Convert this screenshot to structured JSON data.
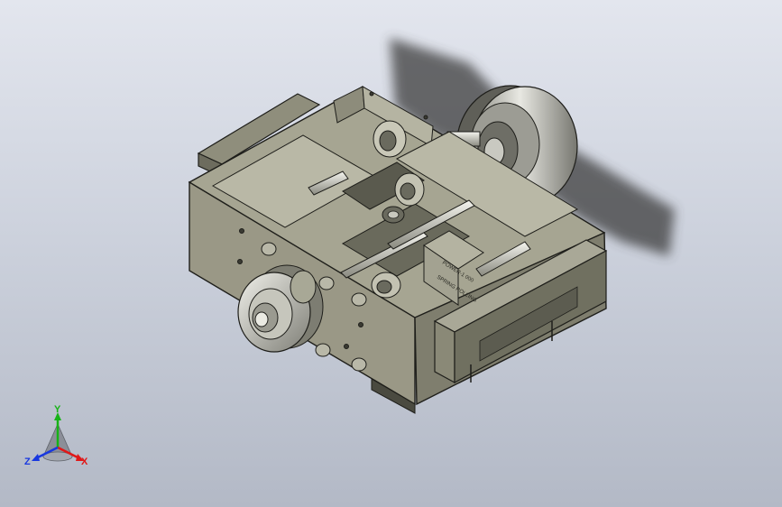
{
  "viewport": {
    "background_top": "#e3e6ee",
    "background_bottom": "#b3b9c6"
  },
  "model": {
    "housing_color": "#9a9886",
    "housing_dark": "#6d6c5e",
    "edge_color": "#1e1e1a",
    "wheel_color": "#b8b8b0",
    "shadow_color": "#3c3c3c",
    "label_plate": {
      "line1": "POWER-1 000",
      "line2": "SPRING ROLLING"
    }
  },
  "triad": {
    "y_label": "Y",
    "x_label": "X",
    "z_label": "Z",
    "y_color": "#17b317",
    "x_color": "#e01818",
    "z_color": "#1838e0"
  }
}
